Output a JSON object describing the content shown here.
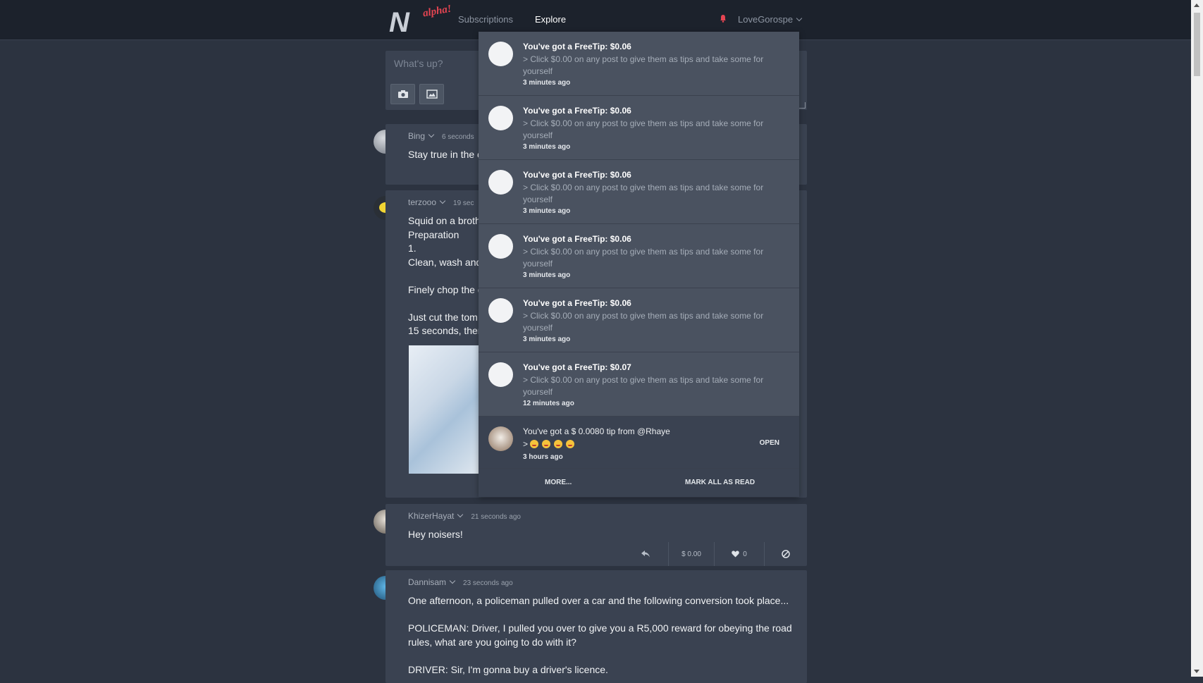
{
  "nav": {
    "logo_letter": "N",
    "logo_tag": "alpha!",
    "subscriptions": "Subscriptions",
    "explore": "Explore",
    "username": "LoveGorospe"
  },
  "composer": {
    "placeholder": "What's up?"
  },
  "posts": [
    {
      "author": "Bing",
      "time": "6 seconds",
      "text": "Stay true in the c"
    },
    {
      "author": "terzooo",
      "time": "19 sec",
      "text": "Squid on a broth\nPreparation\n1.\nClean, wash and\n\nFinely chop the c\n\nJust cut the tom\n15 seconds, ther"
    },
    {
      "author": "KhizerHayat",
      "time": "21 seconds ago",
      "text": "Hey noisers!",
      "tip": "$ 0.00",
      "likes": "0"
    },
    {
      "author": "Dannisam",
      "time": "23 seconds ago",
      "text": "One afternoon, a policeman pulled over a car and the following conversion took place...\n\nPOLICEMAN: Driver, I pulled you over to give you a R5,000 reward for obeying the road rules, what are you going to do with it?\n\nDRIVER: Sir, I'm gonna buy a driver's licence."
    }
  ],
  "notifications": [
    {
      "title": "You've got a FreeTip: $0.06",
      "message": "> Click $0.00 on any post to give them as tips and take some for yourself",
      "time": "3 minutes ago"
    },
    {
      "title": "You've got a FreeTip: $0.06",
      "message": "> Click $0.00 on any post to give them as tips and take some for yourself",
      "time": "3 minutes ago"
    },
    {
      "title": "You've got a FreeTip: $0.06",
      "message": "> Click $0.00 on any post to give them as tips and take some for yourself",
      "time": "3 minutes ago"
    },
    {
      "title": "You've got a FreeTip: $0.06",
      "message": "> Click $0.00 on any post to give them as tips and take some for yourself",
      "time": "3 minutes ago"
    },
    {
      "title": "You've got a FreeTip: $0.06",
      "message": "> Click $0.00 on any post to give them as tips and take some for yourself",
      "time": "3 minutes ago"
    },
    {
      "title": "You've got a FreeTip: $0.07",
      "message": "> Click $0.00 on any post to give them as tips and take some for yourself",
      "time": "12 minutes ago"
    },
    {
      "title": "You've got a $ 0.0080 tip from @Rhaye",
      "message": ">",
      "time": "3 hours ago",
      "action": "OPEN"
    }
  ],
  "dropdown_footer": {
    "more": "MORE...",
    "mark_all": "MARK ALL AS READ"
  },
  "colors": {
    "background": "#2c3340",
    "card": "#3a4251",
    "topbar": "#1c222c",
    "accent": "#e64552"
  }
}
